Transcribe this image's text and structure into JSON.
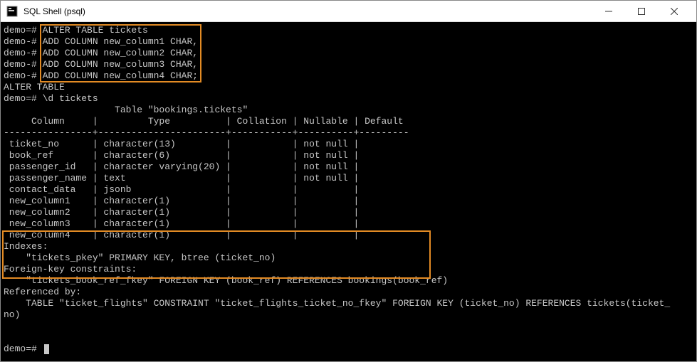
{
  "window": {
    "title": "SQL Shell (psql)"
  },
  "term": {
    "l1p": "demo=# ",
    "l1t": "ALTER TABLE tickets",
    "l2p": "demo-# ",
    "l2t": "ADD COLUMN new_column1 CHAR,",
    "l3p": "demo-# ",
    "l3t": "ADD COLUMN new_column2 CHAR,",
    "l4p": "demo-# ",
    "l4t": "ADD COLUMN new_column3 CHAR,",
    "l5p": "demo-# ",
    "l5t": "ADD COLUMN new_column4 CHAR;",
    "l6": "ALTER TABLE",
    "l7": "demo=# \\d tickets",
    "l8": "                    Table \"bookings.tickets\"",
    "th": "     Column     |         Type          | Collation | Nullable | Default",
    "sep": "----------------+-----------------------+-----------+----------+---------",
    "r1": " ticket_no      | character(13)         |           | not null |",
    "r2": " book_ref       | character(6)          |           | not null |",
    "r3": " passenger_id   | character varying(20) |           | not null |",
    "r4": " passenger_name | text                  |           | not null |",
    "r5": " contact_data   | jsonb                 |           |          |",
    "r6": " new_column1    | character(1)          |           |          |",
    "r7": " new_column2    | character(1)          |           |          |",
    "r8": " new_column3    | character(1)          |           |          |",
    "r9": " new_column4    | character(1)          |           |          |",
    "idx": "Indexes:",
    "idx1": "    \"tickets_pkey\" PRIMARY KEY, btree (ticket_no)",
    "fk": "Foreign-key constraints:",
    "fk1": "    \"tickets_book_ref_fkey\" FOREIGN KEY (book_ref) REFERENCES bookings(book_ref)",
    "ref": "Referenced by:",
    "ref1": "    TABLE \"ticket_flights\" CONSTRAINT \"ticket_flights_ticket_no_fkey\" FOREIGN KEY (ticket_no) REFERENCES tickets(ticket_",
    "ref2": "no)",
    "blank": "",
    "endprompt": "demo=# "
  }
}
